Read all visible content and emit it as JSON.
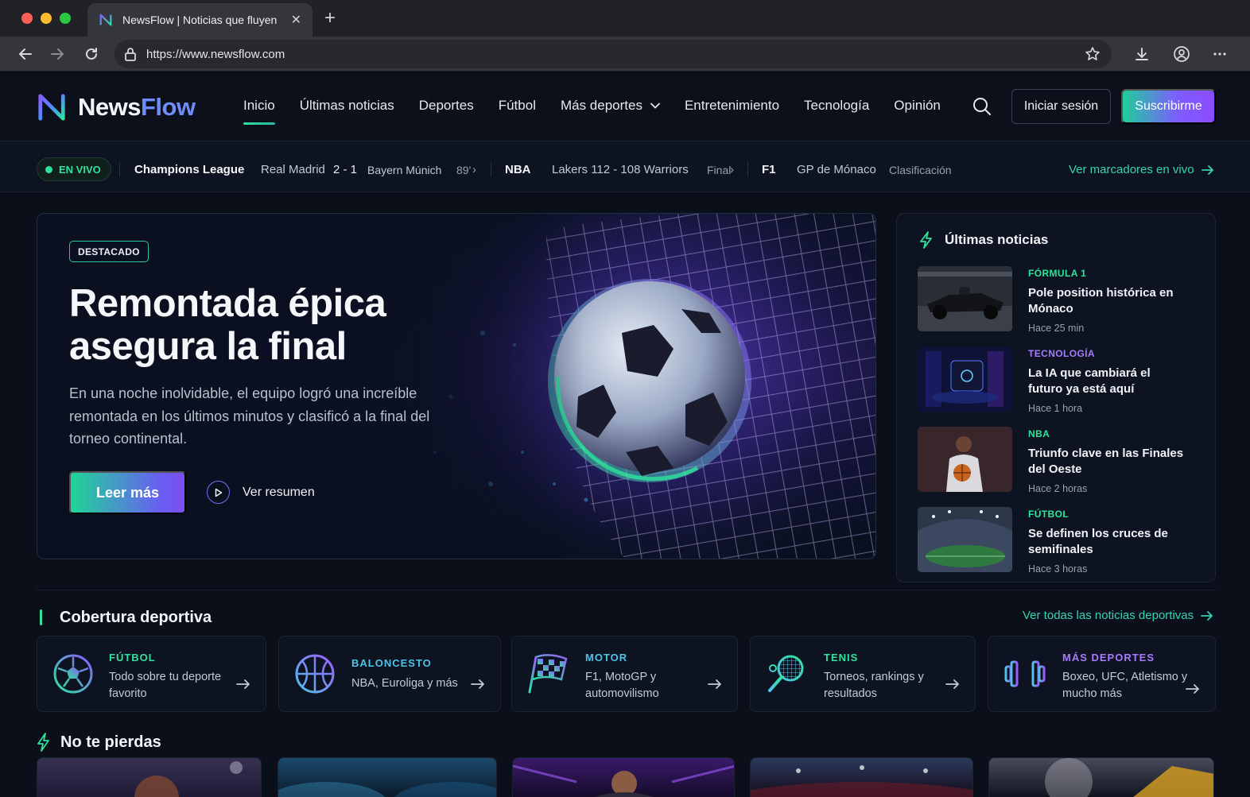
{
  "browser": {
    "tab_title": "NewsFlow | Noticias que fluyen",
    "url": "https://www.newsflow.com"
  },
  "site": {
    "logo_news": "News",
    "logo_flow": "Flow",
    "nav": [
      "Inicio",
      "Últimas noticias",
      "Deportes",
      "Fútbol",
      "Más deportes",
      "Entretenimiento",
      "Tecnología",
      "Opinión"
    ],
    "login_label": "Iniciar sesión",
    "subscribe_label": "Suscribirme"
  },
  "ticker": {
    "live_label": "EN VIVO",
    "cl_league": "Champions League",
    "cl_home": "Real Madrid",
    "cl_score": "2 - 1",
    "cl_away": "Bayern Múnich",
    "cl_minute": "89'",
    "nba_league": "NBA",
    "nba_match": "Lakers 112 - 108 Warriors",
    "nba_status": "Final",
    "f1_league": "F1",
    "f1_event": "GP de Mónaco",
    "f1_status": "Clasificación",
    "all_scores_link": "Ver marcadores en vivo"
  },
  "hero": {
    "badge": "DESTACADO",
    "title_line1": "Remontada épica",
    "title_line2": "asegura la final",
    "description": "En una noche inolvidable, el equipo logró una increíble remontada en los últimos minutos y clasificó a la final del torneo continental.",
    "read_more": "Leer más",
    "watch_summary": "Ver resumen"
  },
  "latest": {
    "title": "Últimas noticias",
    "items": [
      {
        "category": "FÓRMULA 1",
        "title": "Pole position histórica en Mónaco",
        "time": "Hace 25 min",
        "color": "#2ee39b"
      },
      {
        "category": "TECNOLOGÍA",
        "title": "La IA que cambiará el futuro ya está aquí",
        "time": "Hace 1 hora",
        "color": "#a77bff"
      },
      {
        "category": "NBA",
        "title": "Triunfo clave en las Finales del Oeste",
        "time": "Hace 2 horas",
        "color": "#2ee39b"
      },
      {
        "category": "FÚTBOL",
        "title": "Se definen los cruces de semifinales",
        "time": "Hace 3 horas",
        "color": "#2ee39b"
      }
    ]
  },
  "coverage": {
    "title": "Cobertura deportiva",
    "all_link": "Ver todas las noticias deportivas",
    "cards": [
      {
        "category": "FÚTBOL",
        "description": "Todo sobre tu deporte favorito",
        "icon": "soccer-ball-icon",
        "color": "#2ee39b"
      },
      {
        "category": "BALONCESTO",
        "description": "NBA, Euroliga y más",
        "icon": "basketball-icon",
        "color": "#4fc3e8"
      },
      {
        "category": "MOTOR",
        "description": "F1, MotoGP y automovilismo",
        "icon": "checkered-flag-icon",
        "color": "#4fc3e8"
      },
      {
        "category": "TENIS",
        "description": "Torneos, rankings y resultados",
        "icon": "tennis-racket-icon",
        "color": "#2ee39b"
      },
      {
        "category": "MÁS DEPORTES",
        "description": "Boxeo, UFC, Atletismo y mucho más",
        "icon": "dumbbell-icon",
        "color": "#a77bff"
      }
    ]
  },
  "dont_miss": {
    "title": "No te pierdas"
  },
  "colors": {
    "accent_green": "#2ee39b",
    "accent_purple": "#7d5cff",
    "accent_teal": "#35d5b0",
    "background": "#0a0f1a"
  }
}
